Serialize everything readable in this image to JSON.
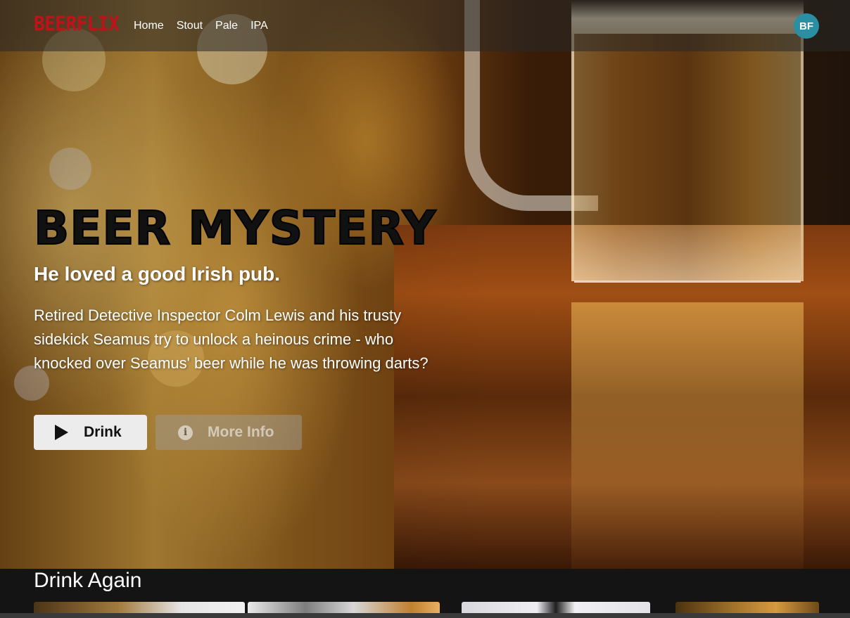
{
  "nav": {
    "logo": "BEERFLIX",
    "links": [
      "Home",
      "Stout",
      "Pale",
      "IPA"
    ],
    "avatar_initials": "BF",
    "avatar_color": "#2a8fa3",
    "brand_color": "#c11119"
  },
  "hero": {
    "title": "BEER MYSTERY",
    "tagline": "He loved a good Irish pub.",
    "description": "Retired Detective Inspector Colm Lewis and his trusty sidekick Seamus try to unlock a heinous crime - who knocked over Seamus' beer while he was throwing darts?",
    "primary_button": "Drink",
    "secondary_button": "More Info",
    "primary_icon": "play-icon",
    "secondary_icon": "info-icon"
  },
  "row": {
    "title": "Drink Again"
  }
}
